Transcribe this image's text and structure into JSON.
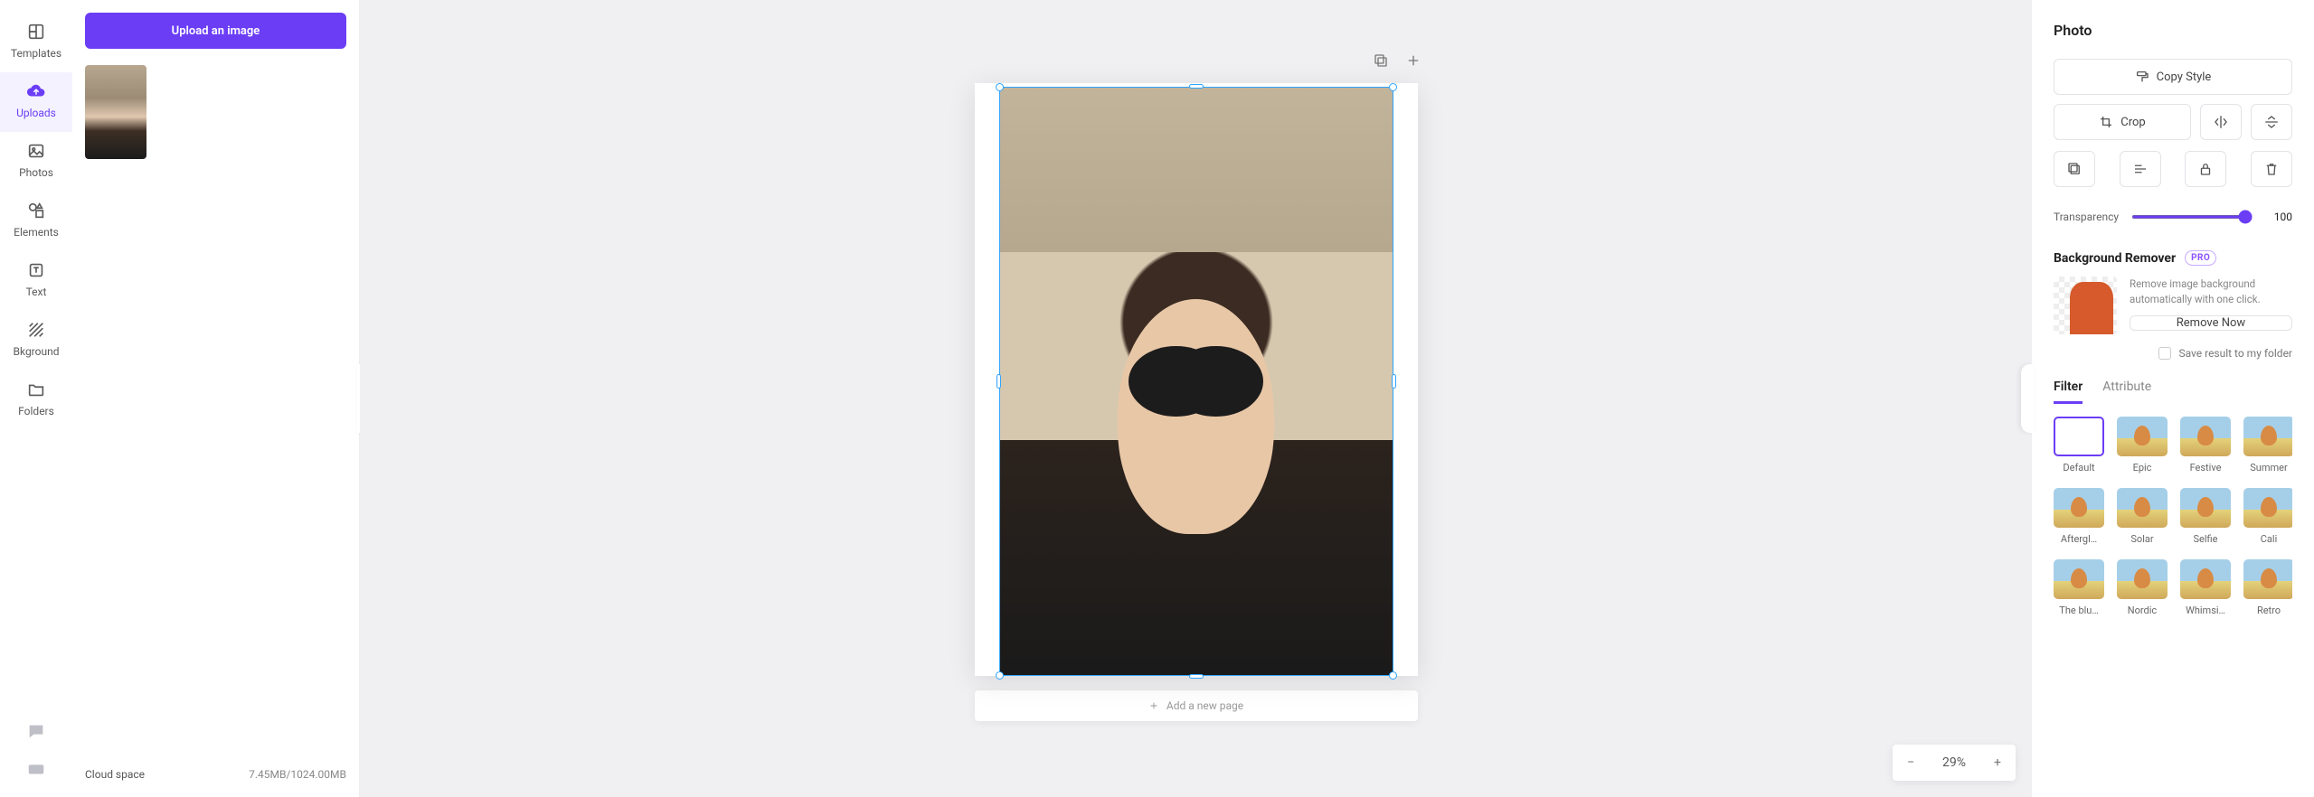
{
  "rail": {
    "items": [
      {
        "label": "Templates"
      },
      {
        "label": "Uploads"
      },
      {
        "label": "Photos"
      },
      {
        "label": "Elements"
      },
      {
        "label": "Text"
      },
      {
        "label": "Bkground"
      },
      {
        "label": "Folders"
      }
    ]
  },
  "side": {
    "upload_label": "Upload an image",
    "cloud_label": "Cloud space",
    "cloud_value": "7.45MB/1024.00MB"
  },
  "canvas": {
    "add_page_label": "Add a new page",
    "zoom_value": "29%"
  },
  "props": {
    "title": "Photo",
    "copy_style_label": "Copy Style",
    "crop_label": "Crop",
    "transparency_label": "Transparency",
    "transparency_value": "100",
    "bg_remover_title": "Background Remover",
    "pro_label": "PRO",
    "bg_remover_desc": "Remove image background automatically with one click.",
    "remove_now_label": "Remove Now",
    "save_result_label": "Save result to my folder",
    "tabs": {
      "filter": "Filter",
      "attribute": "Attribute"
    },
    "filters": [
      {
        "label": "Default",
        "blank": true
      },
      {
        "label": "Epic"
      },
      {
        "label": "Festive"
      },
      {
        "label": "Summer"
      },
      {
        "label": "Aftergl…"
      },
      {
        "label": "Solar"
      },
      {
        "label": "Selfie"
      },
      {
        "label": "Cali"
      },
      {
        "label": "The blu…"
      },
      {
        "label": "Nordic"
      },
      {
        "label": "Whimsi…"
      },
      {
        "label": "Retro"
      }
    ]
  }
}
